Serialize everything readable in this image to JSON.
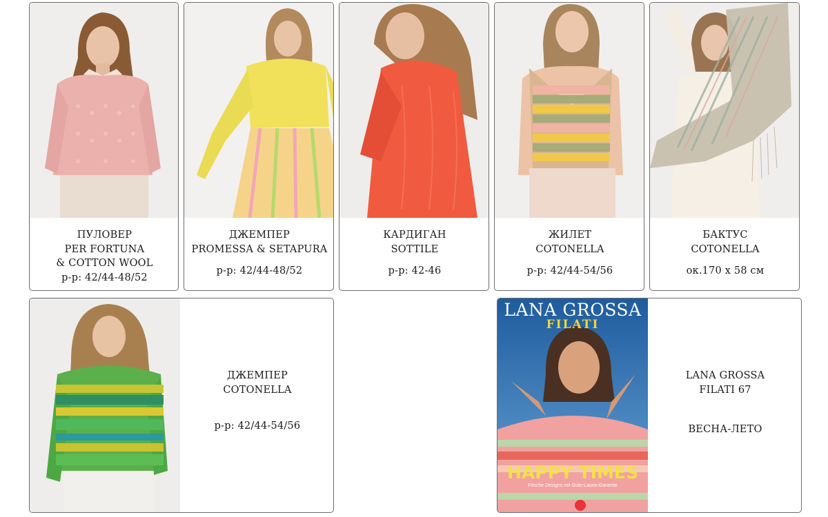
{
  "products": [
    {
      "title": [
        "ПУЛОВЕР",
        "PER FORTUNA",
        "& COTTON WOOL"
      ],
      "size": "р-р: 42/44-48/52"
    },
    {
      "title": [
        "ДЖЕМПЕР",
        "PROMESSA & SETAPURA"
      ],
      "size": "р-р: 42/44-48/52"
    },
    {
      "title": [
        "КАРДИГАН",
        "SOTTILE"
      ],
      "size": "р-р: 42-46"
    },
    {
      "title": [
        "ЖИЛЕТ",
        "COTONELLA"
      ],
      "size": "р-р: 42/44-54/56"
    },
    {
      "title": [
        "БАКТУС",
        "COTONELLA"
      ],
      "size": "ок.170 х 58 см"
    },
    {
      "title": [
        "ДЖЕМПЕР",
        "COTONELLA"
      ],
      "size": "р-р: 42/44-54/56"
    }
  ],
  "magazine": {
    "title": [
      "LANA GROSSA",
      "FILATI 67"
    ],
    "season": "ВЕСНА-ЛЕТО",
    "cover": {
      "brand": "LANA GROSSA",
      "series": "Filati",
      "headline": "HAPPY TIMES",
      "tagline": "Frische Designs mit Gute-Laune-Garantie"
    }
  }
}
